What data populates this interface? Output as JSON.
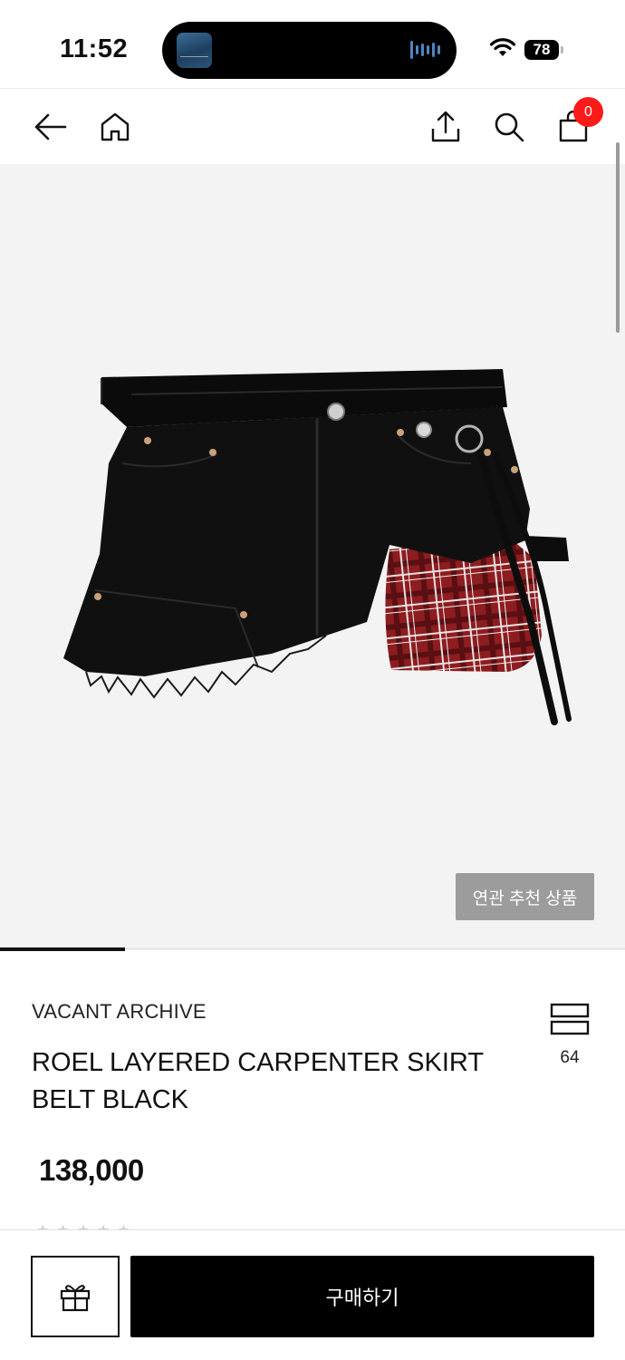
{
  "status_bar": {
    "time": "11:52",
    "battery": "78"
  },
  "nav": {
    "icons": [
      "back-arrow-icon",
      "home-icon",
      "share-icon",
      "search-icon",
      "shopping-bag-icon"
    ],
    "cart_count": "0"
  },
  "gallery": {
    "related_button_label": "연관 추천 상품",
    "progress_fraction": 0.2
  },
  "product": {
    "brand": "VACANT ARCHIVE",
    "name": "ROEL LAYERED CARPENTER SKIRT BELT BLACK",
    "price": "138,000",
    "wish_count": "64",
    "rating_stars": "★★★★★"
  },
  "bottom_bar": {
    "gift_icon": "gift-icon",
    "buy_label": "구매하기"
  },
  "colors": {
    "accent": "#000000",
    "badge": "#ff1a1a",
    "background_image": "#f3f3f3"
  }
}
